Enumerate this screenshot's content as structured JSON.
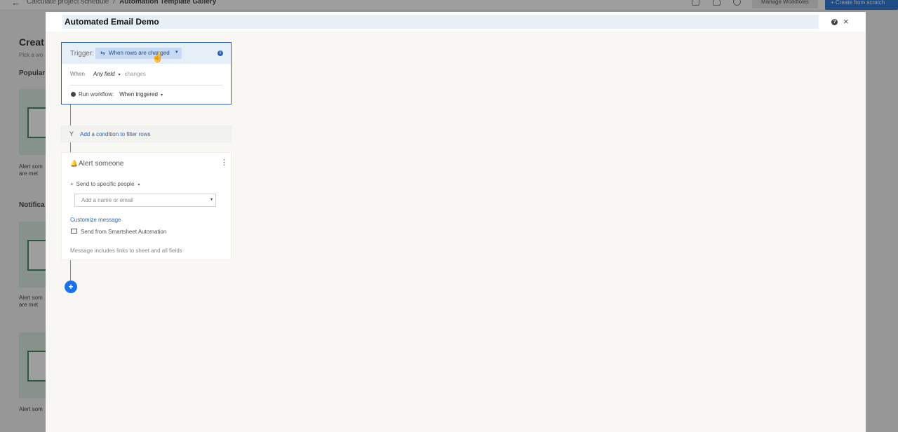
{
  "background": {
    "back_glyph": "←",
    "breadcrumb": {
      "parent": "Calculate project schedule",
      "separator": "/",
      "current": "Automation Template Gallery"
    },
    "manage_workflows_label": "Manage Workflows",
    "create_from_scratch_label": "+ Create from scratch",
    "heading": "Creat",
    "subheading": "Pick a wo",
    "sections": [
      "Popular",
      "Notifica"
    ],
    "cards": [
      {
        "label_line1": "Alert som",
        "label_line2": "are met"
      },
      {
        "label_line1": "Alert som",
        "label_line2": "are met"
      },
      {
        "label_line1": "Alert som",
        "label_line2": ""
      }
    ]
  },
  "modal": {
    "title": "Automated Email Demo",
    "help_glyph": "?",
    "close_glyph": "×"
  },
  "trigger": {
    "label": "Trigger:",
    "type_icon": "rows-changed-icon",
    "type_glyph": "⇆",
    "type_value": "When rows are changed",
    "info_glyph": "i",
    "when_label": "When",
    "field_value": "Any field",
    "changes_label": "changes",
    "run_label": "Run workflow:",
    "run_value": "When triggered"
  },
  "condition": {
    "glyph": "Y",
    "link_label": "Add a condition to filter rows"
  },
  "alert": {
    "bell_glyph": "🔔",
    "title": "Alert someone",
    "menu_glyph": "⋮",
    "send_to_glyph": "+",
    "send_to_label": "Send to specific people",
    "recipient_placeholder": "Add a name or email",
    "customize_label": "Customize message",
    "send_from_label": "Send from Smartsheet Automation",
    "note": "Message includes links to sheet and all fields"
  },
  "add_step_glyph": "+",
  "colors": {
    "accent": "#2d64b0",
    "chip_bg": "#c8daf3",
    "add_button": "#1a73e8",
    "create_button": "#1b6ad3",
    "card_green": "#2e7d4f"
  }
}
